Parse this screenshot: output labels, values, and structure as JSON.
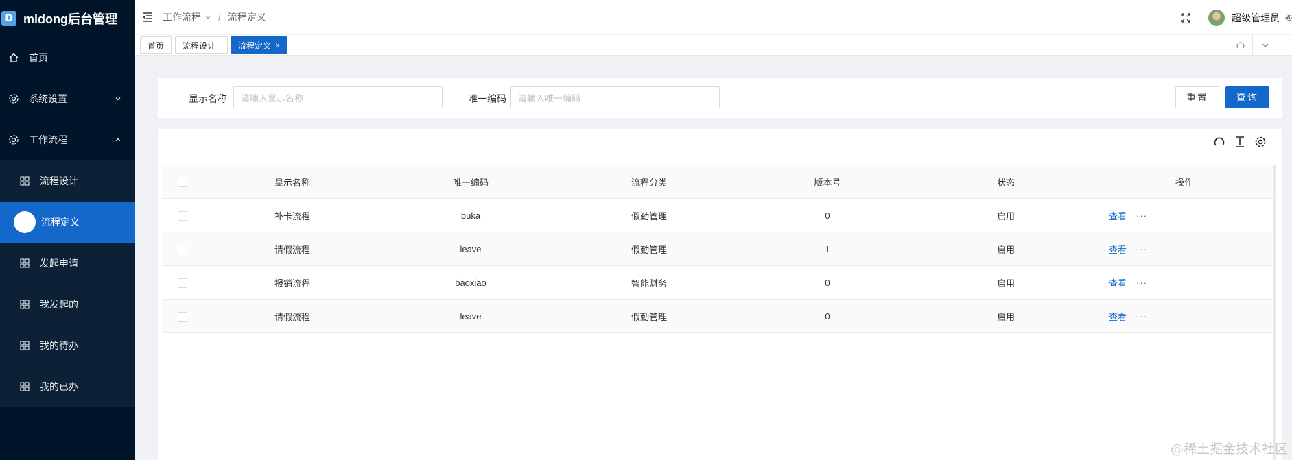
{
  "app": {
    "logo_letter": "D",
    "title": "mldong后台管理"
  },
  "sidebar": {
    "items": [
      {
        "label": "首页",
        "icon": "home-icon"
      },
      {
        "label": "系统设置",
        "icon": "gear-icon"
      },
      {
        "label": "工作流程",
        "icon": "gear-icon"
      }
    ],
    "submenu": [
      {
        "label": "流程设计"
      },
      {
        "label": "流程定义"
      },
      {
        "label": "发起申请"
      },
      {
        "label": "我发起的"
      },
      {
        "label": "我的待办"
      },
      {
        "label": "我的已办"
      }
    ]
  },
  "header": {
    "breadcrumb": [
      "工作流程",
      "流程定义"
    ],
    "username": "超级管理员"
  },
  "tabs": [
    {
      "label": "首页"
    },
    {
      "label": "流程设计"
    },
    {
      "label": "流程定义",
      "close": "×"
    }
  ],
  "search": {
    "name_label": "显示名称",
    "name_placeholder": "请输入显示名称",
    "code_label": "唯一编码",
    "code_placeholder": "请输入唯一编码",
    "reset_label": "重置",
    "query_label": "查询"
  },
  "table": {
    "columns": [
      "显示名称",
      "唯一编码",
      "流程分类",
      "版本号",
      "状态",
      "操作"
    ],
    "rows": [
      {
        "name": "补卡流程",
        "code": "buka",
        "category": "假勤管理",
        "version": "0",
        "status": "启用",
        "view": "查看",
        "more": "···"
      },
      {
        "name": "请假流程",
        "code": "leave",
        "category": "假勤管理",
        "version": "1",
        "status": "启用",
        "view": "查看",
        "more": "···"
      },
      {
        "name": "报销流程",
        "code": "baoxiao",
        "category": "智能财务",
        "version": "0",
        "status": "启用",
        "view": "查看",
        "more": "···"
      },
      {
        "name": "请假流程",
        "code": "leave",
        "category": "假勤管理",
        "version": "0",
        "status": "启用",
        "view": "查看",
        "more": "···"
      }
    ]
  },
  "watermark": "@稀土掘金技术社区",
  "colors": {
    "sidebar_bg": "#001529",
    "primary": "#1368c9"
  }
}
